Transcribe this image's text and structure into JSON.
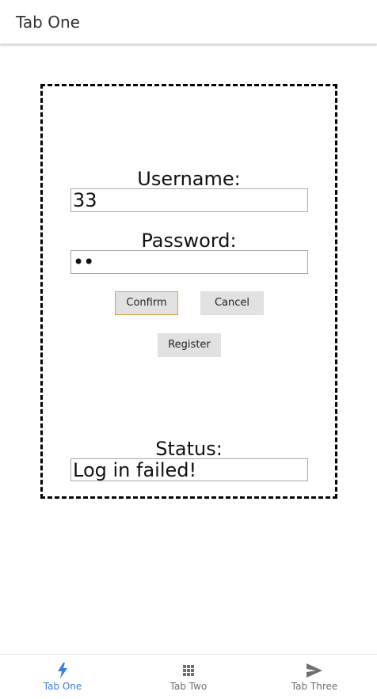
{
  "header": {
    "title": "Tab One"
  },
  "login": {
    "username_label": "Username:",
    "username_value": "33",
    "password_label": "Password:",
    "password_value": "••",
    "confirm_label": "Confirm",
    "cancel_label": "Cancel",
    "register_label": "Register",
    "status_label": "Status:",
    "status_value": "Log in failed!"
  },
  "tabs": [
    {
      "label": "Tab One",
      "icon": "flash-icon",
      "active": true
    },
    {
      "label": "Tab Two",
      "icon": "apps-grid-icon",
      "active": false
    },
    {
      "label": "Tab Three",
      "icon": "send-icon",
      "active": false
    }
  ],
  "colors": {
    "accent": "#3b7de0",
    "inactive_tab": "#6f6f6f",
    "focus_border": "#e0a13a",
    "button_bg": "#e1e1e1"
  }
}
